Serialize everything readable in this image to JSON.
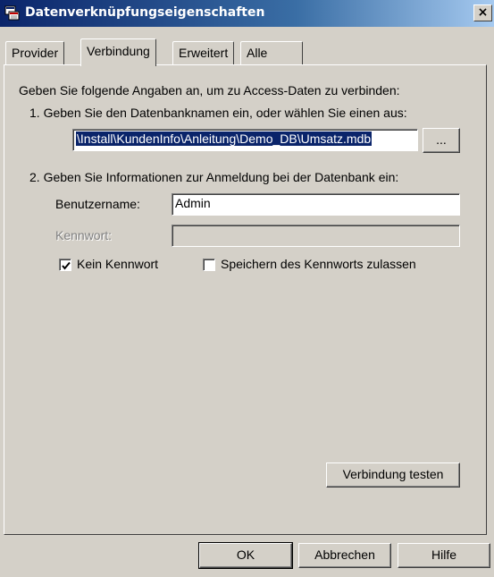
{
  "window": {
    "title": "Datenverknüpfungseigenschaften",
    "close_glyph": "×",
    "icon": "data-link-icon"
  },
  "tabs": [
    {
      "label": "Provider",
      "active": false
    },
    {
      "label": "Verbindung",
      "active": true
    },
    {
      "label": "Erweitert",
      "active": false
    },
    {
      "label": "Alle",
      "active": false
    }
  ],
  "connection": {
    "intro": "Geben Sie folgende Angaben an, um zu Access-Daten zu verbinden:",
    "step1_label": "1. Geben Sie den Datenbanknamen ein, oder wählen Sie einen aus:",
    "database_path": "\\Install\\KundenInfo\\Anleitung\\Demo_DB\\Umsatz.mdb",
    "browse_label": "...",
    "step2_label": "2. Geben Sie Informationen zur Anmeldung bei der Datenbank ein:",
    "username_label": "Benutzername:",
    "username_value": "Admin",
    "password_label": "Kennwort:",
    "password_value": "",
    "no_password_label": "Kein Kennwort",
    "no_password_checked": true,
    "save_password_label": "Speichern des Kennworts zulassen",
    "save_password_checked": false,
    "test_button_label": "Verbindung testen"
  },
  "footer": {
    "ok_label": "OK",
    "cancel_label": "Abbrechen",
    "help_label": "Hilfe"
  },
  "colors": {
    "title_start": "#0a246a",
    "title_end": "#a6caf0",
    "face": "#d4d0c8",
    "selection": "#0a246a"
  }
}
